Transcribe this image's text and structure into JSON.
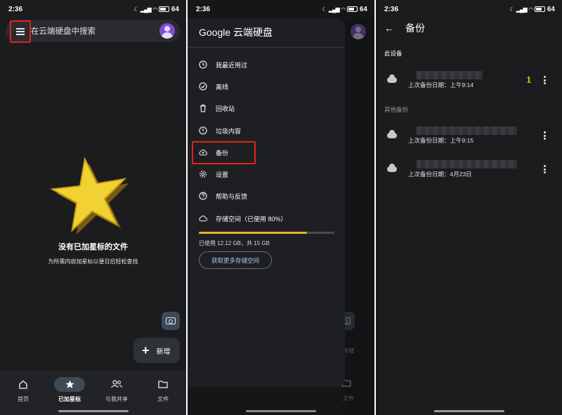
{
  "colors": {
    "highlight_box": "#e0231b",
    "storage_bar": "#e7b52a",
    "link": "#a8c7fa",
    "avatar": "#7e4fd6"
  },
  "status_bar": {
    "time": "2:36",
    "battery": "64"
  },
  "panel1": {
    "search_placeholder": "在云端硬盘中搜索",
    "empty_title": "没有已加星标的文件",
    "empty_subtitle": "为所需内容加星标以便日后轻松查找",
    "new_label": "新增",
    "nav": [
      {
        "label": "首页",
        "icon": "home-icon"
      },
      {
        "label": "已加星标",
        "icon": "star-icon"
      },
      {
        "label": "与我共享",
        "icon": "people-icon"
      },
      {
        "label": "文件",
        "icon": "folder-icon"
      }
    ]
  },
  "panel2": {
    "title": "Google 云端硬盘",
    "items": [
      {
        "label": "我最近用过",
        "icon": "clock-icon"
      },
      {
        "label": "离线",
        "icon": "offline-icon"
      },
      {
        "label": "回收站",
        "icon": "trash-icon"
      },
      {
        "label": "垃圾内容",
        "icon": "spam-icon"
      },
      {
        "label": "备份",
        "icon": "cloud-backup-icon"
      },
      {
        "label": "设置",
        "icon": "gear-icon"
      },
      {
        "label": "帮助与反馈",
        "icon": "help-icon"
      },
      {
        "label": "存储空间（已使用 80%）",
        "icon": "cloud-icon"
      }
    ],
    "storage_fraction": 0.8,
    "storage_used": "已使用 12.12 GB，共 15 GB",
    "get_more_storage": "获取更多存储空间",
    "ghost_new": "新增",
    "ghost_files": "文件"
  },
  "panel3": {
    "title": "备份",
    "this_device_label": "此设备",
    "other_backups_label": "其他备份",
    "devices": [
      {
        "date": "上次备份日期：上午9:14"
      },
      {
        "date": "上次备份日期：上午9:15"
      },
      {
        "date": "上次备份日期：4月23日"
      }
    ]
  }
}
